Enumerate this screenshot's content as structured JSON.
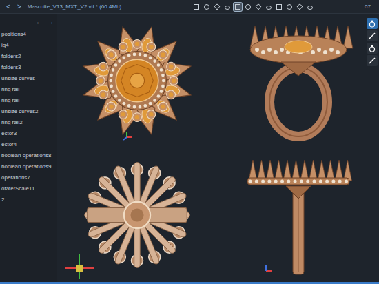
{
  "window": {
    "title": "Mascotte_V13_MXT_V2.vif * (60.4Mb)",
    "nav": [
      "<",
      ">"
    ],
    "corner": "07"
  },
  "toolbar": {
    "tools": [
      {
        "selected": false
      },
      {
        "selected": false
      },
      {
        "selected": false
      },
      {
        "selected": false
      },
      {
        "selected": true
      },
      {
        "selected": false
      },
      {
        "selected": false
      },
      {
        "selected": false
      },
      {
        "selected": false
      },
      {
        "selected": false
      },
      {
        "selected": false
      },
      {
        "selected": false
      }
    ]
  },
  "sidebar": {
    "nav": [
      "←",
      "→"
    ],
    "items": [
      "positions4",
      "ig4",
      "folders2",
      "folders3",
      "unsize curves",
      "ring rail",
      "ring rail",
      "unsize curves2",
      "ring rail2",
      "ector3",
      "ector4",
      "boolean operations8",
      "boolean operations9",
      "operations7",
      "otate/Scale11",
      "2"
    ]
  },
  "side_tools": [
    {
      "selected": true
    },
    {
      "selected": false
    },
    {
      "selected": false
    },
    {
      "selected": false
    }
  ]
}
